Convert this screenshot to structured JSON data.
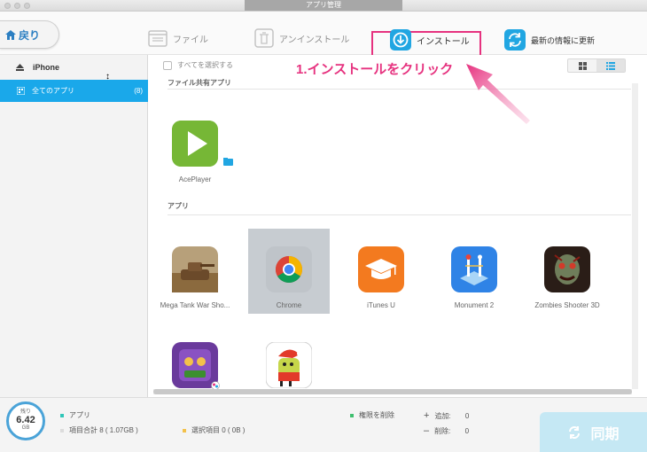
{
  "window": {
    "title": "アプリ管理"
  },
  "toolbar": {
    "back_label": "戻り",
    "files_label": "ファイル",
    "uninstall_label": "アンインストール",
    "install_label": "インストール",
    "refresh_label": "最新の情報に更新"
  },
  "sidebar": {
    "device_name": "iPhone",
    "all_apps_label": "全てのアプリ",
    "all_apps_count": "(8)"
  },
  "content": {
    "select_all_label": "すべてを選択する",
    "file_sharing_section": "ファイル共有アプリ",
    "apps_section": "アプリ",
    "file_sharing_apps": [
      {
        "name": "AcePlayer"
      }
    ],
    "apps": [
      {
        "name": "Mega Tank War Sho...",
        "icon": "tank-icon",
        "color": "#8b5a2b"
      },
      {
        "name": "Chrome",
        "icon": "chrome-icon",
        "color": "#ffffff",
        "selected": true
      },
      {
        "name": "iTunes U",
        "icon": "itunes-u-icon",
        "color": "#f37a1f"
      },
      {
        "name": "Monument 2",
        "icon": "monument-icon",
        "color": "#2b7be0"
      },
      {
        "name": "Zombies Shooter 3D",
        "icon": "zombie-icon",
        "color": "#3a2a22"
      },
      {
        "name": "",
        "icon": "temple-run-icon",
        "color": "#6a3a9c"
      },
      {
        "name": "",
        "icon": "doodle-jump-icon",
        "color": "#e23a2a"
      }
    ]
  },
  "annotation": {
    "text": "1.インストールをクリック",
    "color": "#e6327f"
  },
  "bottom": {
    "gauge_label": "残り",
    "gauge_value": "6.42",
    "gauge_unit": "GB",
    "apps_label": "アプリ",
    "total_label": "項目合計 8 ( 1.07GB )",
    "selected_label": "選択項目 0 ( 0B )",
    "delete_perm_label": "権限を削除",
    "add_label": "追加:",
    "add_count": "0",
    "delete_label": "削除:",
    "delete_count": "0",
    "sync_label": "同期"
  },
  "colors": {
    "accent": "#1aa8ea",
    "annotation": "#e6327f",
    "sync": "#c5e8f4"
  }
}
